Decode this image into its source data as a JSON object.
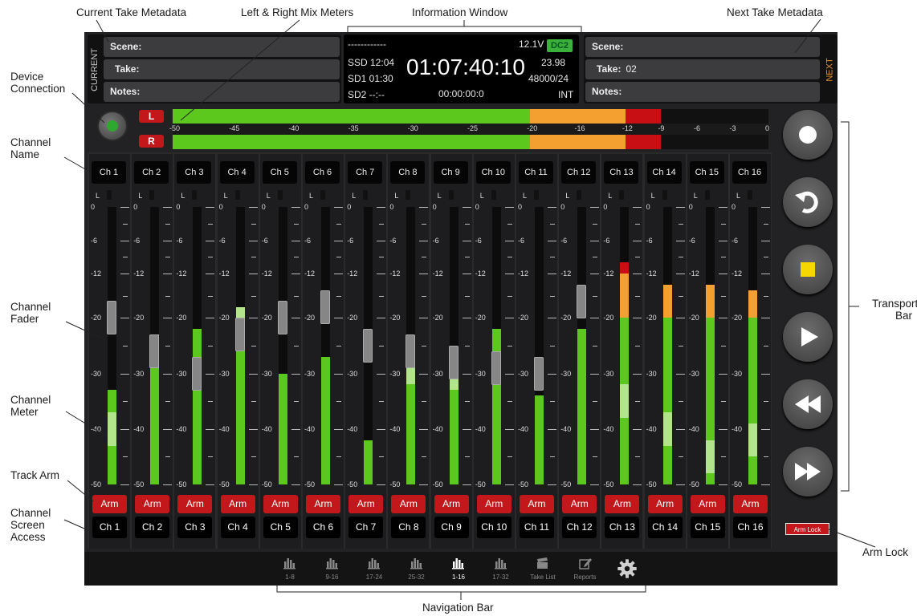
{
  "annotations": {
    "current_take": "Current Take Metadata",
    "mix_meters": "Left & Right Mix Meters",
    "info_window": "Information Window",
    "next_take": "Next Take Metadata",
    "device_connection": "Device\nConnection",
    "channel_name": "Channel\nName",
    "channel_fader": "Channel\nFader",
    "channel_meter": "Channel\nMeter",
    "track_arm": "Track Arm",
    "screen_access": "Channel\nScreen\nAccess",
    "transport_bar": "Transport\nBar",
    "arm_lock": "Arm Lock",
    "navigation_bar": "Navigation Bar"
  },
  "current": {
    "side_label": "CURRENT",
    "scene_label": "Scene:",
    "scene_value": "",
    "take_label": "Take:",
    "take_value": "",
    "notes_label": "Notes:",
    "notes_value": ""
  },
  "next": {
    "side_label": "NEXT",
    "scene_label": "Scene:",
    "scene_value": "",
    "take_label": "Take:",
    "take_value": "02",
    "notes_label": "Notes:",
    "notes_value": ""
  },
  "info": {
    "dashes": "------------",
    "voltage": "12.1V",
    "power": "DC2",
    "ssd": "SSD 12:04",
    "sd1": "SD1 01:30",
    "sd2": "SD2 --:--",
    "timecode": "01:07:40:10",
    "fps": "23.98",
    "sample_rate": "48000/24",
    "counter": "00:00:00:0",
    "tc_source": "INT"
  },
  "mix_meter": {
    "left_label": "L",
    "right_label": "R",
    "ticks": [
      "-50",
      "-45",
      "-40",
      "-35",
      "-30",
      "-25",
      "-20",
      "-16",
      "-12",
      "-9",
      "-6",
      "-3",
      "0"
    ],
    "tick_values": [
      -50,
      -45,
      -40,
      -35,
      -30,
      -25,
      -20,
      -16,
      -12,
      -9,
      -6,
      -3,
      0
    ],
    "left_level_db": -7,
    "right_level_db": -7,
    "colors": {
      "green": "#5cc81e",
      "orange": "#f4a030",
      "red": "#c80f14"
    }
  },
  "scale": {
    "labels": [
      "0",
      "-6",
      "-12",
      "-20",
      "-30",
      "-40",
      "-50"
    ],
    "values": [
      0,
      -6,
      -12,
      -20,
      -30,
      -40,
      -50
    ],
    "meter_label": "L"
  },
  "channels": [
    {
      "name": "Ch 1",
      "arm": "Arm",
      "access": "Ch 1",
      "level_db": -33,
      "peak_db": -40,
      "fader_db": -20
    },
    {
      "name": "Ch 2",
      "arm": "Arm",
      "access": "Ch 2",
      "level_db": -24,
      "peak_db": -26,
      "fader_db": -26
    },
    {
      "name": "Ch 3",
      "arm": "Arm",
      "access": "Ch 3",
      "level_db": -22,
      "peak_db": -30,
      "fader_db": -30
    },
    {
      "name": "Ch 4",
      "arm": "Arm",
      "access": "Ch 4",
      "level_db": -20,
      "peak_db": -21,
      "fader_db": -23
    },
    {
      "name": "Ch 5",
      "arm": "Arm",
      "access": "Ch 5",
      "level_db": -30,
      "peak_db": -30,
      "fader_db": -20
    },
    {
      "name": "Ch 6",
      "arm": "Arm",
      "access": "Ch 6",
      "level_db": -27,
      "peak_db": -27,
      "fader_db": -18
    },
    {
      "name": "Ch 7",
      "arm": "Arm",
      "access": "Ch 7",
      "level_db": -42,
      "peak_db": -42,
      "fader_db": -25
    },
    {
      "name": "Ch 8",
      "arm": "Arm",
      "access": "Ch 8",
      "level_db": -28,
      "peak_db": -29,
      "fader_db": -26
    },
    {
      "name": "Ch 9",
      "arm": "Arm",
      "access": "Ch 9",
      "level_db": -28,
      "peak_db": -30,
      "fader_db": -28
    },
    {
      "name": "Ch 10",
      "arm": "Arm",
      "access": "Ch 10",
      "level_db": -22,
      "peak_db": -29,
      "fader_db": -29
    },
    {
      "name": "Ch 11",
      "arm": "Arm",
      "access": "Ch 11",
      "level_db": -34,
      "peak_db": -34,
      "fader_db": -30
    },
    {
      "name": "Ch 12",
      "arm": "Arm",
      "access": "Ch 12",
      "level_db": -22,
      "peak_db": -22,
      "fader_db": -17
    },
    {
      "name": "Ch 13",
      "arm": "Arm",
      "access": "Ch 13",
      "level_db": -10,
      "peak_db": -35,
      "fader_db": null
    },
    {
      "name": "Ch 14",
      "arm": "Arm",
      "access": "Ch 14",
      "level_db": -14,
      "peak_db": -40,
      "fader_db": null
    },
    {
      "name": "Ch 15",
      "arm": "Arm",
      "access": "Ch 15",
      "level_db": -14,
      "peak_db": -45,
      "fader_db": null
    },
    {
      "name": "Ch 16",
      "arm": "Arm",
      "access": "Ch 16",
      "level_db": -15,
      "peak_db": -42,
      "fader_db": null
    }
  ],
  "meter_colors": {
    "green": "#5cc81e",
    "peak": "#b2e48c",
    "orange": "#f4a030",
    "red": "#c80f14"
  },
  "transport": {
    "buttons": [
      {
        "name": "record",
        "icon": "record-icon"
      },
      {
        "name": "undo",
        "icon": "undo-icon"
      },
      {
        "name": "stop",
        "icon": "stop-icon"
      },
      {
        "name": "play",
        "icon": "play-icon"
      },
      {
        "name": "rewind",
        "icon": "rewind-icon"
      },
      {
        "name": "fast-forward",
        "icon": "fast-forward-icon"
      }
    ],
    "arm_lock": "Arm Lock"
  },
  "nav": {
    "items": [
      {
        "label": "1-8",
        "icon": "bars-icon",
        "active": false
      },
      {
        "label": "9-16",
        "icon": "bars-icon",
        "active": false
      },
      {
        "label": "17-24",
        "icon": "bars-icon",
        "active": false
      },
      {
        "label": "25-32",
        "icon": "bars-icon",
        "active": false
      },
      {
        "label": "1-16",
        "icon": "bars-icon",
        "active": true
      },
      {
        "label": "17-32",
        "icon": "bars-icon",
        "active": false
      },
      {
        "label": "Take List",
        "icon": "clapper-icon",
        "active": false
      },
      {
        "label": "Reports",
        "icon": "edit-icon",
        "active": false
      },
      {
        "label": "",
        "icon": "gear-icon",
        "active": false
      }
    ]
  }
}
